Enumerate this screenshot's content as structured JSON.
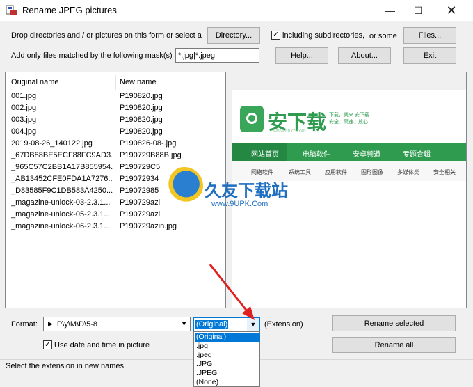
{
  "window": {
    "title": "Rename JPEG pictures"
  },
  "top": {
    "drop_text": "Drop directories and / or pictures on this form or select a",
    "directory_button": "Directory...",
    "include_subdirs_label": "including subdirectories,",
    "include_subdirs_checked": true,
    "or_some_label": "or some",
    "files_button": "Files...",
    "mask_label": "Add only files matched by the following mask(s) :",
    "mask_value": "*.jpg|*.jpeg",
    "help_button": "Help...",
    "about_button": "About...",
    "exit_button": "Exit"
  },
  "list": {
    "col1_header": "Original name",
    "col2_header": "New name",
    "rows": [
      {
        "original": "001.jpg",
        "new": "P190820.jpg"
      },
      {
        "original": "002.jpg",
        "new": "P190820.jpg"
      },
      {
        "original": "003.jpg",
        "new": "P190820.jpg"
      },
      {
        "original": "004.jpg",
        "new": "P190820.jpg"
      },
      {
        "original": "2019-08-26_140122.jpg",
        "new": "P190826-08-.jpg"
      },
      {
        "original": "_67DB88BE5ECF88FC9AD3...",
        "new": "P190729B88B.jpg"
      },
      {
        "original": "_965C57C2BB1A17B855954...",
        "new": "P190729C5"
      },
      {
        "original": "_AB13452CFE0FDA1A7276...",
        "new": "P19072934"
      },
      {
        "original": "_D83585F9C1DB583A4250...",
        "new": "P19072985"
      },
      {
        "original": "_magazine-unlock-03-2.3.1...",
        "new": "P190729azi"
      },
      {
        "original": "_magazine-unlock-05-2.3.1...",
        "new": "P190729azi"
      },
      {
        "original": "_magazine-unlock-06-2.3.1...",
        "new": "P190729azin.jpg"
      }
    ]
  },
  "preview": {
    "site_title": "安下载",
    "site_slogan_1": "下载，就来 安下载",
    "site_slogan_2": "安全、高速、放心",
    "site_domain": "www.anxz.com",
    "nav": [
      "网站首页",
      "电脑软件",
      "安卓频道",
      "专题合辑"
    ],
    "subnav": [
      "网络软件",
      "系统工具",
      "应用软件",
      "图形图像",
      "多媒体类",
      "安全相关"
    ],
    "watermark_title": "久友下载站",
    "watermark_url": "www.9UPK.Com",
    "colors": {
      "site_green": "#2e9b4f",
      "nav_green": "#3aa65a"
    }
  },
  "bottom": {
    "format_label": "Format:",
    "format_value": "P\\y\\M\\D\\5-8",
    "extension_value": "(Original)",
    "extension_label": "(Extension)",
    "extension_options": [
      "(Original)",
      ".jpg",
      ".jpeg",
      ".JPG",
      ".JPEG",
      "(None)"
    ],
    "use_date_label": "Use date and time in picture",
    "use_date_checked": true,
    "rename_selected_button": "Rename selected",
    "rename_all_button": "Rename all"
  },
  "status": {
    "text": "Select the extension in new names"
  },
  "icons": [
    "app-icon",
    "minimize-icon",
    "maximize-icon",
    "close-icon",
    "play-icon",
    "dropdown-arrow-icon",
    "check-icon",
    "red-arrow-icon"
  ]
}
